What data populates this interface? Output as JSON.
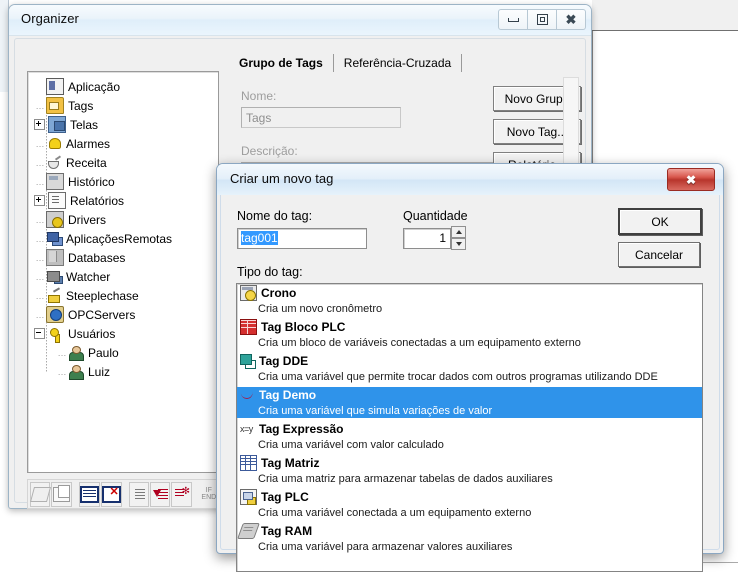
{
  "organizer": {
    "title": "Organizer",
    "window_buttons": [
      {
        "name": "minimize",
        "glyph": "minimize-icon"
      },
      {
        "name": "maximize",
        "glyph": "maximize-icon"
      },
      {
        "name": "close",
        "glyph": "close-icon"
      }
    ],
    "tabs": [
      {
        "label": "Grupo de Tags",
        "active": true
      },
      {
        "label": "Referência-Cruzada",
        "active": false
      }
    ],
    "fields": {
      "nome_label": "Nome:",
      "nome_value": "Tags",
      "descricao_label": "Descrição:"
    },
    "buttons": {
      "novo_grupo": "Novo Grupo",
      "novo_tag": "Novo Tag...",
      "relatorio": "Relatório..."
    },
    "tree": [
      {
        "label": "Aplicação",
        "depth": 0,
        "icon": "application-icon",
        "expander": "none"
      },
      {
        "label": "Tags",
        "depth": 1,
        "icon": "folder-icon",
        "expander": "none"
      },
      {
        "label": "Telas",
        "depth": 1,
        "icon": "screens-icon",
        "expander": "plus"
      },
      {
        "label": "Alarmes",
        "depth": 1,
        "icon": "bell-icon",
        "expander": "none"
      },
      {
        "label": "Receita",
        "depth": 1,
        "icon": "recipe-icon",
        "expander": "none"
      },
      {
        "label": "Histórico",
        "depth": 1,
        "icon": "history-icon",
        "expander": "none"
      },
      {
        "label": "Relatórios",
        "depth": 1,
        "icon": "report-icon",
        "expander": "plus"
      },
      {
        "label": "Drivers",
        "depth": 1,
        "icon": "driver-icon",
        "expander": "none"
      },
      {
        "label": "AplicaçõesRemotas",
        "depth": 1,
        "icon": "remote-apps-icon",
        "expander": "none"
      },
      {
        "label": "Databases",
        "depth": 1,
        "icon": "database-icon",
        "expander": "none"
      },
      {
        "label": "Watcher",
        "depth": 1,
        "icon": "watcher-icon",
        "expander": "none"
      },
      {
        "label": "Steeplechase",
        "depth": 1,
        "icon": "steeplechase-icon",
        "expander": "none"
      },
      {
        "label": "OPCServers",
        "depth": 1,
        "icon": "opc-server-icon",
        "expander": "none"
      },
      {
        "label": "Usuários",
        "depth": 1,
        "icon": "key-icon",
        "expander": "minus"
      },
      {
        "label": "Paulo",
        "depth": 2,
        "icon": "user-icon",
        "expander": "none"
      },
      {
        "label": "Luiz",
        "depth": 2,
        "icon": "user-icon",
        "expander": "none"
      }
    ],
    "toolbar": [
      {
        "name": "erase-button",
        "icon": "eraser-icon",
        "enabled": false
      },
      {
        "name": "copy-button",
        "icon": "copy-icon",
        "enabled": false
      },
      {
        "name": "properties-button",
        "icon": "grid-icon",
        "enabled": true
      },
      {
        "name": "delete-button",
        "icon": "grid-delete-icon",
        "enabled": true
      },
      {
        "name": "sort-button",
        "icon": "sort-icon",
        "enabled": false
      },
      {
        "name": "insert-row-button",
        "icon": "insert-row-icon",
        "enabled": true
      },
      {
        "name": "find-button",
        "icon": "find-icon",
        "enabled": true
      },
      {
        "name": "if-end-button",
        "icon": "if-end-icon",
        "enabled": false,
        "text": "IF\nEND"
      }
    ]
  },
  "dialog": {
    "title": "Criar um novo tag",
    "close_label": "✕",
    "name_label": "Nome do tag:",
    "name_value": "tag001",
    "quantity_label": "Quantidade",
    "quantity_value": "1",
    "type_label": "Tipo do tag:",
    "ok_label": "OK",
    "cancel_label": "Cancelar",
    "tag_types": [
      {
        "name": "Crono",
        "desc": "Cria um novo cronômetro",
        "icon": "stopwatch-icon",
        "selected": false
      },
      {
        "name": "Tag Bloco PLC",
        "desc": "Cria um bloco de variáveis conectadas a um equipamento externo",
        "icon": "brick-wall-icon",
        "selected": false
      },
      {
        "name": "Tag DDE",
        "desc": "Cria uma variável que permite trocar dados com outros programas utilizando DDE",
        "icon": "dde-icon",
        "selected": false
      },
      {
        "name": "Tag Demo",
        "desc": "Cria uma variável que simula variações de valor",
        "icon": "waveform-icon",
        "selected": true
      },
      {
        "name": "Tag Expressão",
        "desc": "Cria uma variável com valor calculado",
        "icon": "expression-icon",
        "selected": false
      },
      {
        "name": "Tag Matriz",
        "desc": "Cria uma matriz para armazenar tabelas de dados auxiliares",
        "icon": "table-icon",
        "selected": false
      },
      {
        "name": "Tag PLC",
        "desc": "Cria uma variável conectada a um equipamento externo",
        "icon": "plc-icon",
        "selected": false
      },
      {
        "name": "Tag RAM",
        "desc": "Cria uma variável para armazenar valores auxiliares",
        "icon": "ram-chip-icon",
        "selected": false
      }
    ]
  },
  "colors": {
    "selection": "#2f93ea",
    "title_gradient_start": "#f4f9fd",
    "title_gradient_end": "#d3e6f6",
    "close_button": "#c0392b"
  }
}
